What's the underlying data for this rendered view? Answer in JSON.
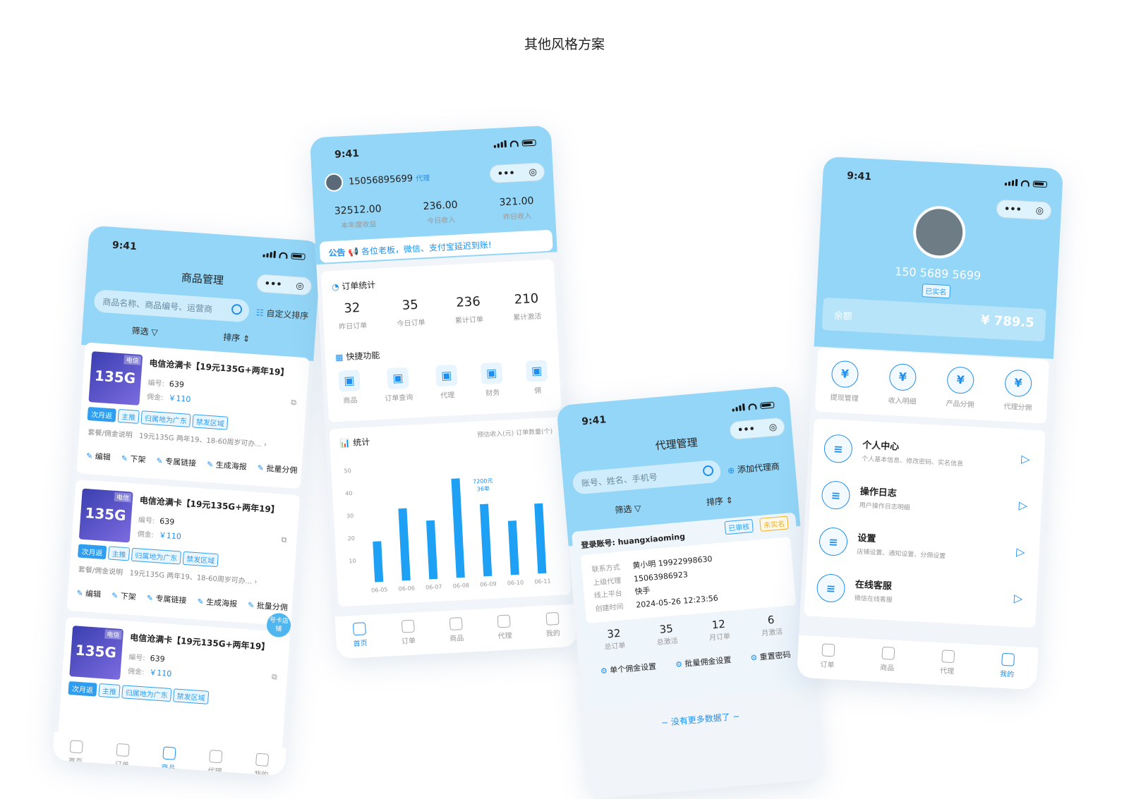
{
  "page": {
    "title": "其他风格方案"
  },
  "status": {
    "time": "9:41"
  },
  "capsule": {
    "dots": "•••",
    "target": "◎"
  },
  "goods": {
    "title": "商品管理",
    "search_placeholder": "商品名称、商品编号、运营商",
    "custom_sort": "自定义排序",
    "filter": "筛选",
    "sort": "排序",
    "items": [
      {
        "name": "电信沧满卡【19元135G+两年19】",
        "badge": "135G",
        "carrier": "电信",
        "id_label": "编号:",
        "id": "639",
        "comm_label": "佣金:",
        "comm": "￥110",
        "tags": [
          "次月返",
          "主推",
          "归属地为广东",
          "禁发区域"
        ],
        "desc_label": "套餐/佣金说明",
        "desc": "19元135G 两年19、18-60周岁可办..."
      },
      {
        "name": "电信沧满卡【19元135G+两年19】",
        "badge": "135G",
        "carrier": "电信",
        "id_label": "编号:",
        "id": "639",
        "comm_label": "佣金:",
        "comm": "￥110",
        "tags": [
          "次月返",
          "主推",
          "归属地为广东",
          "禁发区域"
        ],
        "desc_label": "套餐/佣金说明",
        "desc": "19元135G 两年19、18-60周岁可办..."
      },
      {
        "name": "电信沧满卡【19元135G+两年19】",
        "badge": "135G",
        "carrier": "电信",
        "id_label": "编号:",
        "id": "639",
        "comm_label": "佣金:",
        "comm": "￥110",
        "tags": [
          "次月返",
          "主推",
          "归属地为广东",
          "禁发区域"
        ]
      }
    ],
    "actions": [
      "编辑",
      "下架",
      "专属链接",
      "生成海报",
      "批量分佣"
    ],
    "float_badge": "号卡店铺",
    "tabs": [
      "首页",
      "订单",
      "商品",
      "代理",
      "我的"
    ]
  },
  "home": {
    "phone": "15056895699",
    "role": "代理",
    "stats": [
      {
        "value": "32512.00",
        "label": "本年度收益"
      },
      {
        "value": "236.00",
        "label": "今日收入"
      },
      {
        "value": "321.00",
        "label": "昨日收入"
      }
    ],
    "notice_label": "公告",
    "notice": "各位老板，微信、支付宝延迟到账!",
    "order_title": "订单统计",
    "orders": [
      {
        "value": "32",
        "label": "昨日订单"
      },
      {
        "value": "35",
        "label": "今日订单"
      },
      {
        "value": "236",
        "label": "累计订单"
      },
      {
        "value": "210",
        "label": "累计激活"
      }
    ],
    "quick_title": "快捷功能",
    "quick": [
      "商品",
      "订单查询",
      "代理",
      "财务",
      "佣"
    ],
    "tabs": [
      "首页",
      "订单",
      "商品",
      "代理",
      "我的"
    ]
  },
  "chart_data": {
    "type": "bar",
    "title": "统计",
    "legend": [
      "预估收入(元)",
      "订单数量(个)"
    ],
    "categories": [
      "06-05",
      "06-06",
      "06-07",
      "06-08",
      "06-09",
      "06-10",
      "06-11"
    ],
    "values": [
      18,
      32,
      26,
      44,
      32,
      24,
      31
    ],
    "yticks": [
      "50",
      "40",
      "30",
      "20",
      "10"
    ],
    "ylim": [
      0,
      50
    ],
    "tooltip": {
      "line1": "7200元",
      "line2": "36单"
    }
  },
  "agent": {
    "title": "代理管理",
    "search_placeholder": "账号、姓名、手机号",
    "add": "添加代理商",
    "filter": "筛选",
    "sort": "排序",
    "account_label": "登录账号:",
    "account": "huangxiaoming",
    "badge1": "已审核",
    "badge2": "未实名",
    "rows": [
      {
        "k": "联系方式",
        "v": "黄小明  19922998630"
      },
      {
        "k": "上级代理",
        "v": "15063986923"
      },
      {
        "k": "线上平台",
        "v": "快手"
      },
      {
        "k": "创建时间",
        "v": "2024-05-26 12:23:56"
      }
    ],
    "stats": [
      {
        "value": "32",
        "label": "总订单"
      },
      {
        "value": "35",
        "label": "总激活"
      },
      {
        "value": "12",
        "label": "月订单"
      },
      {
        "value": "6",
        "label": "月激活"
      }
    ],
    "actions": [
      "单个佣金设置",
      "批量佣金设置",
      "重置密码"
    ],
    "nomore": "~ 没有更多数据了 ~"
  },
  "mine": {
    "phone": "150 5689 5699",
    "verified": "已实名",
    "balance_label": "余额",
    "balance": "¥ 789.5",
    "grid": [
      "提现管理",
      "收入明细",
      "产品分佣",
      "代理分佣"
    ],
    "menu": [
      {
        "title": "个人中心",
        "sub": "个人基本信息、修改密码、实名信息"
      },
      {
        "title": "操作日志",
        "sub": "用户操作日志明细"
      },
      {
        "title": "设置",
        "sub": "店铺设置、通知设置、分佣设置"
      },
      {
        "title": "在线客服",
        "sub": "微信在线客服"
      }
    ],
    "tabs": [
      "订单",
      "商品",
      "代理",
      "我的"
    ]
  }
}
